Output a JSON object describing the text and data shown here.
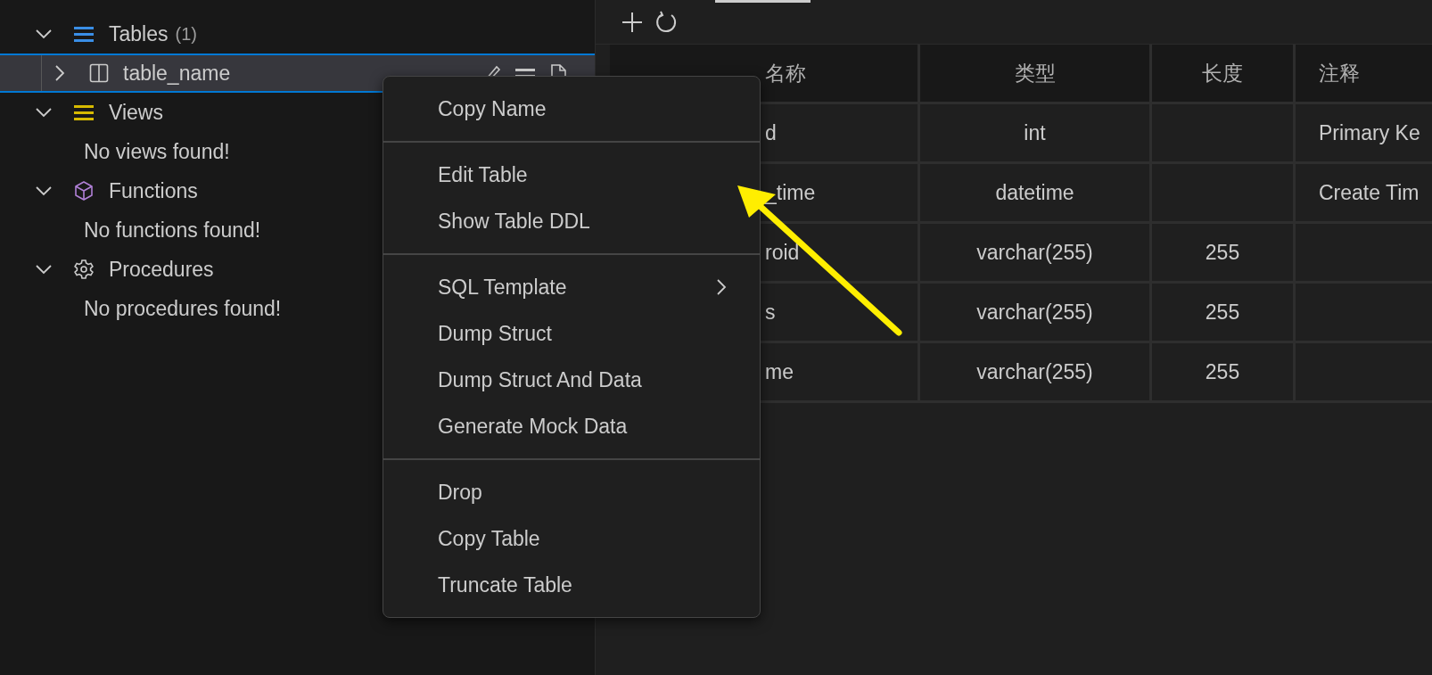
{
  "sidebar": {
    "items": [
      {
        "kind": "tables",
        "label": "Tables",
        "count": "(1)",
        "expanded": true,
        "children": [
          {
            "kind": "table",
            "label": "table_name",
            "expanded": false,
            "selected": true
          }
        ]
      },
      {
        "kind": "views",
        "label": "Views",
        "expanded": true,
        "children": [
          {
            "kind": "message",
            "label": "No views found!"
          }
        ]
      },
      {
        "kind": "functions",
        "label": "Functions",
        "expanded": true,
        "children": [
          {
            "kind": "message",
            "label": "No functions found!"
          }
        ]
      },
      {
        "kind": "procedures",
        "label": "Procedures",
        "expanded": true,
        "children": [
          {
            "kind": "message",
            "label": "No procedures found!"
          }
        ]
      }
    ]
  },
  "table": {
    "columns": [
      "名称",
      "类型",
      "长度",
      "注释"
    ],
    "rows": [
      {
        "name": "d",
        "type": "int",
        "comment": "Primary Ke"
      },
      {
        "name": "_time",
        "type": "datetime",
        "comment": "Create Tim"
      },
      {
        "name": "roid",
        "type": "varchar(255)",
        "length": "255"
      },
      {
        "name": "s",
        "type": "varchar(255)",
        "length": "255"
      },
      {
        "name": "me",
        "type": "varchar(255)",
        "length": "255"
      }
    ]
  },
  "context_menu": {
    "groups": [
      [
        {
          "label": "Copy Name",
          "submenu": false
        }
      ],
      [
        {
          "label": "Edit Table",
          "submenu": false
        },
        {
          "label": "Show Table DDL",
          "submenu": false
        }
      ],
      [
        {
          "label": "SQL Template",
          "submenu": true
        },
        {
          "label": "Dump Struct",
          "submenu": false
        },
        {
          "label": "Dump Struct And Data",
          "submenu": false
        },
        {
          "label": "Generate Mock Data",
          "submenu": false
        }
      ],
      [
        {
          "label": "Drop",
          "submenu": false
        },
        {
          "label": "Copy Table",
          "submenu": false
        },
        {
          "label": "Truncate Table",
          "submenu": false
        }
      ]
    ]
  }
}
